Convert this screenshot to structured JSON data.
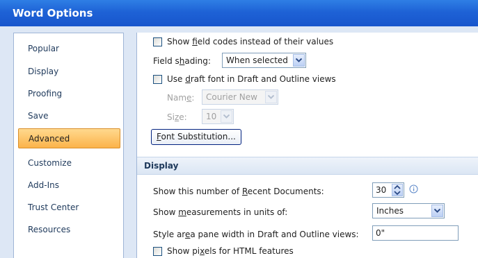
{
  "window": {
    "title": "Word Options"
  },
  "sidebar": {
    "items": [
      {
        "label": "Popular"
      },
      {
        "label": "Display"
      },
      {
        "label": "Proofing"
      },
      {
        "label": "Save"
      },
      {
        "label": "Advanced",
        "active": true
      },
      {
        "label": "Customize"
      },
      {
        "label": "Add-Ins"
      },
      {
        "label": "Trust Center"
      },
      {
        "label": "Resources"
      }
    ]
  },
  "content": {
    "show_field_codes": {
      "pre": "Show ",
      "accel": "f",
      "post": "ield codes instead of their values",
      "checked": false
    },
    "field_shading": {
      "pre": "Field s",
      "accel": "h",
      "post": "ading:",
      "value": "When selected"
    },
    "draft_font": {
      "pre": "Use ",
      "accel": "d",
      "post": "raft font in Draft and Outline views",
      "checked": false
    },
    "name": {
      "pre": "Nam",
      "accel": "e",
      "post": ":",
      "value": "Courier New"
    },
    "size": {
      "pre": "Si",
      "accel": "z",
      "post": "e:",
      "value": "10"
    },
    "font_substitution": {
      "accel": "F",
      "post": "ont Substitution..."
    },
    "display_section": {
      "title": "Display"
    },
    "recent_docs": {
      "pre": "Show this number of ",
      "accel": "R",
      "post": "ecent Documents:",
      "value": "30"
    },
    "units": {
      "pre": "Show ",
      "accel": "m",
      "post": "easurements in units of:",
      "value": "Inches"
    },
    "style_area": {
      "pre": "Style ar",
      "accel": "e",
      "post": "a pane width in Draft and Outline views:",
      "value": "0\""
    },
    "show_pixels": {
      "pre": "Show pi",
      "accel": "x",
      "post": "els for HTML features",
      "checked": false
    }
  },
  "colors": {
    "title_bar": "#1e62d6",
    "active_item": "#fbb34a",
    "accent_text": "#1e395b"
  }
}
